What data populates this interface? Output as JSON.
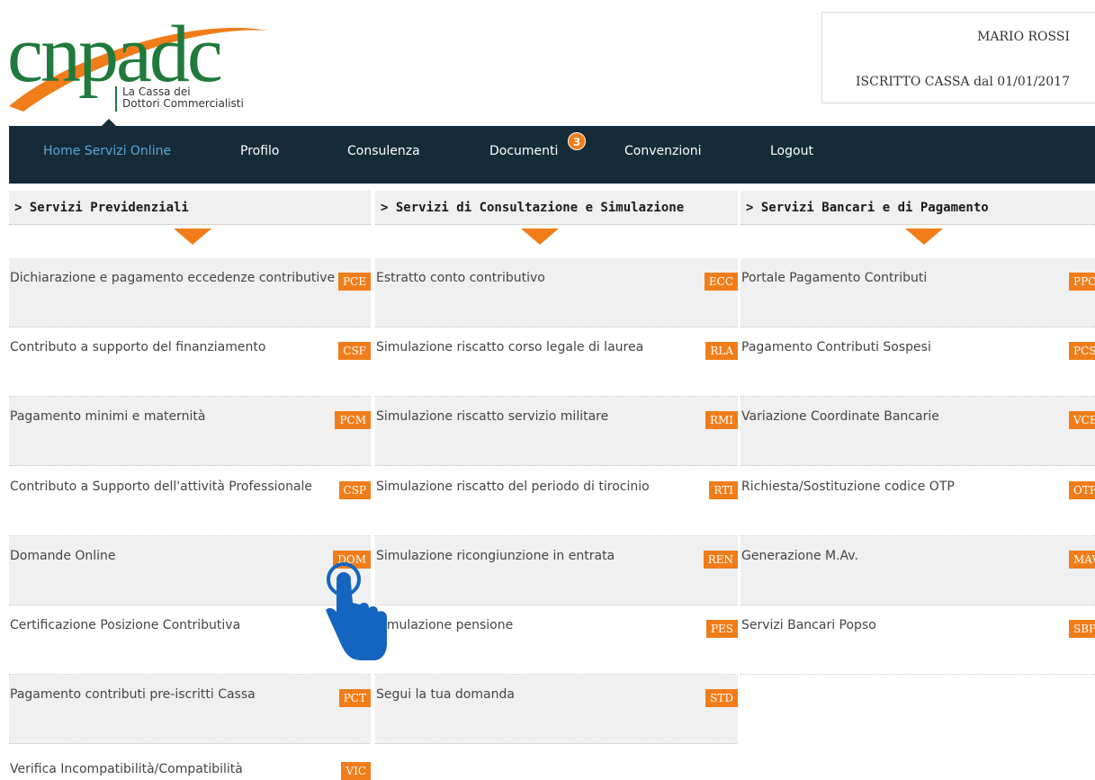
{
  "logo": {
    "wordmark": "cnpadc",
    "tagline_1": "La Cassa dei",
    "tagline_2": "Dottori Commercialisti"
  },
  "user": {
    "name": "MARIO ROSSI",
    "since": "ISCRITTO CASSA dal 01/01/2017"
  },
  "nav": {
    "items": [
      {
        "label": "Home Servizi Online",
        "active": true
      },
      {
        "label": "Profilo"
      },
      {
        "label": "Consulenza"
      },
      {
        "label": "Documenti"
      },
      {
        "label": "Convenzioni"
      },
      {
        "label": "Logout"
      }
    ],
    "documents_badge": "3"
  },
  "sections": [
    {
      "title": "> Servizi Previdenziali"
    },
    {
      "title": "> Servizi di Consultazione e Simulazione"
    },
    {
      "title": "> Servizi Bancari e di Pagamento"
    }
  ],
  "columns": {
    "previdenziali": [
      {
        "label": "Dichiarazione e pagamento eccedenze contributive",
        "code": "PCE"
      },
      {
        "label": "Contributo a supporto del finanziamento",
        "code": "CSF"
      },
      {
        "label": "Pagamento minimi e maternità",
        "code": "PCM"
      },
      {
        "label": "Contributo a Supporto dell'attività Professionale",
        "code": "CSP"
      },
      {
        "label": "Domande Online",
        "code": "DOM"
      },
      {
        "label": "Certificazione Posizione Contributiva",
        "code": ""
      },
      {
        "label": "Pagamento contributi pre-iscritti Cassa",
        "code": "PCT"
      },
      {
        "label": "Verifica Incompatibilità/Compatibilità",
        "code": "VIC"
      }
    ],
    "consultazione": [
      {
        "label": "Estratto conto contributivo",
        "code": "ECC"
      },
      {
        "label": "Simulazione riscatto corso legale di laurea",
        "code": "RLA"
      },
      {
        "label": "Simulazione riscatto servizio militare",
        "code": "RMI"
      },
      {
        "label": "Simulazione riscatto del periodo di tirocinio",
        "code": "RTI"
      },
      {
        "label": "Simulazione ricongiunzione in entrata",
        "code": "REN"
      },
      {
        "label": "imulazione pensione",
        "code": "PES"
      },
      {
        "label": "Segui la tua domanda",
        "code": "STD"
      }
    ],
    "bancari": [
      {
        "label": "Portale Pagamento Contributi",
        "code": "PPC"
      },
      {
        "label": "Pagamento Contributi Sospesi",
        "code": "PCS"
      },
      {
        "label": "Variazione Coordinate Bancarie",
        "code": "VCB"
      },
      {
        "label": "Richiesta/Sostituzione codice OTP",
        "code": "OTP"
      },
      {
        "label": "Generazione M.Av.",
        "code": "MAV"
      },
      {
        "label": "Servizi Bancari Popso",
        "code": "SBP"
      }
    ]
  },
  "colors": {
    "nav_bg": "#152b38",
    "accent": "#f07d1a",
    "brand_green": "#1f7a3c",
    "active_link": "#5aa8d8",
    "pointer": "#1565c0"
  },
  "pointer_icon": "hand-pointer-icon"
}
